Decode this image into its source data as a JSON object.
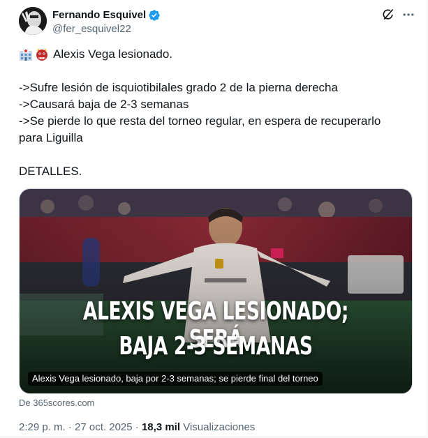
{
  "author": {
    "display_name": "Fernando Esquivel",
    "handle": "@fer_esquivel22",
    "verified_color": "#1d9bf0"
  },
  "actions": {
    "grok_icon": "grok-icon",
    "more_icon": "more-icon"
  },
  "tweet": {
    "emojis": [
      "hospital-emoji",
      "ogre-emoji"
    ],
    "headline": "Alexis Vega lesionado.",
    "lines": [
      "->Sufre lesión de isquiotibilales grado 2 de la pierna derecha",
      "->Causará baja de 2-3 semanas",
      "->Se pierde lo que resta del torneo regular, en espera de recuperarlo",
      "para Liguilla"
    ],
    "footer": "DETALLES."
  },
  "media": {
    "headline_line1": "ALEXIS VEGA LESIONADO; SERÁ",
    "headline_line2": "BAJA 2-3 SEMANAS",
    "caption": "Alexis Vega lesionado, baja por 2-3 semanas; se pierde final del torneo",
    "source": "De 365scores.com"
  },
  "meta": {
    "time": "2:29 p. m.",
    "separator": "·",
    "date": "27 oct. 2025",
    "views_count": "18,3 mil",
    "views_label": "Visualizaciones"
  }
}
